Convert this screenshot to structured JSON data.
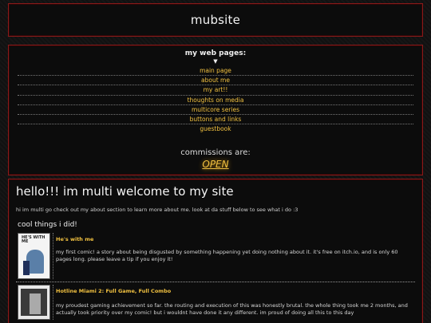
{
  "header": {
    "title": "mubsite"
  },
  "nav": {
    "title": "my web pages:",
    "arrow": "▼",
    "links": [
      "main page",
      "about me",
      "my art!!",
      "thoughts on media",
      "multicore series",
      "buttons and links",
      "guestbook"
    ],
    "commissions_label": "commissions are:",
    "commissions_status": "OPEN"
  },
  "main": {
    "welcome": "hello!!! im multi welcome to my site",
    "intro": "hi im multi go check out my about section to learn more about me. look at da stuff below to see what i do :3",
    "cool_heading": "cool things i did!",
    "items": [
      {
        "title": "He's with me",
        "thumb_text": "HE'S WITH ME",
        "desc": "my first comic! a story about being disgusted by something happening yet doing nothing about it. it's free on itch.io, and is only 60 pages long. please leave a tip if you enjoy it!"
      },
      {
        "title": "Hotline Miami 2: Full Game, Full Combo",
        "desc": "my proudest gaming achievement so far. the routing and execution of this was honestly brutal. the whole thing took me 2 months, and actually took priority over my comic! but i wouldnt have done it any different. im proud of doing all this to this day"
      }
    ]
  },
  "colors": {
    "accent": "#f0c040",
    "border": "#8a1a1a",
    "background": "#121212"
  }
}
